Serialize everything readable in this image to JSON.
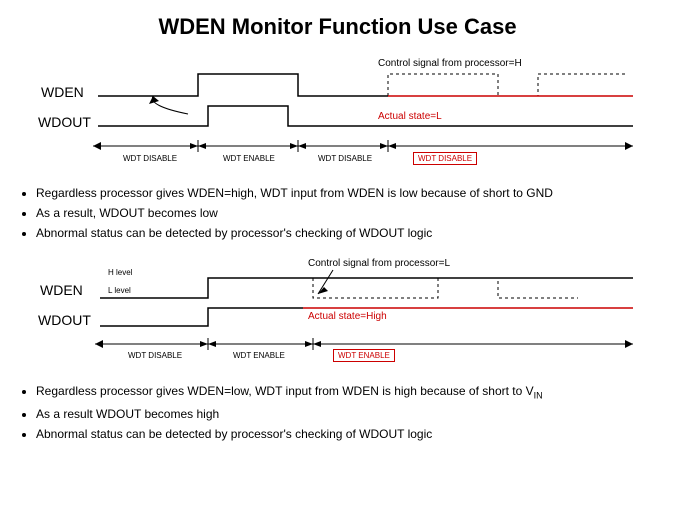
{
  "title": "WDEN Monitor Function Use Case",
  "diagram1": {
    "wden_label": "WDEN",
    "wdout_label": "WDOUT",
    "ctrl_label": "Control signal from processor=H",
    "actual_label": "Actual state=L",
    "seg1": "WDT DISABLE",
    "seg2": "WDT ENABLE",
    "seg3": "WDT DISABLE",
    "seg4": "WDT DISABLE"
  },
  "bullets1": {
    "b1": "Regardless processor gives WDEN=high, WDT input from WDEN is low because of short to GND",
    "b2": "As a result, WDOUT becomes low",
    "b3": "Abnormal status can be detected by processor's checking of WDOUT logic"
  },
  "diagram2": {
    "wden_label": "WDEN",
    "wdout_label": "WDOUT",
    "h_level": "H level",
    "l_level": "L level",
    "ctrl_label": "Control signal from processor=L",
    "actual_label": "Actual state=High",
    "seg1": "WDT DISABLE",
    "seg2": "WDT ENABLE",
    "seg3": "WDT ENABLE"
  },
  "bullets2": {
    "b1_prefix": "Regardless processor gives WDEN=low, WDT input from WDEN is high because of short to V",
    "b1_sub": "IN",
    "b2": "As a result WDOUT becomes high",
    "b3": "Abnormal status can be detected by processor's checking of WDOUT logic"
  },
  "chart_data": [
    {
      "type": "timing-diagram",
      "title": "WDEN short to GND case",
      "signals": [
        {
          "name": "WDEN",
          "processor_intent": "H (after pulse)",
          "actual": "L",
          "segments": [
            "low",
            "high-pulse",
            "low-actual (dotted high = intended)"
          ]
        },
        {
          "name": "WDOUT",
          "actual": "L",
          "segments": [
            "low",
            "high-pulse",
            "low"
          ]
        }
      ],
      "axis_segments": [
        "WDT DISABLE",
        "WDT ENABLE",
        "WDT DISABLE",
        "WDT DISABLE (abnormal)"
      ],
      "annotations": [
        "Control signal from processor=H",
        "Actual state=L"
      ]
    },
    {
      "type": "timing-diagram",
      "title": "WDEN short to VIN case",
      "signals": [
        {
          "name": "WDEN",
          "processor_intent": "L (after step)",
          "actual": "H",
          "segments": [
            "low",
            "step high (actual stays high, dotted low = intended)"
          ]
        },
        {
          "name": "WDOUT",
          "actual": "H",
          "segments": [
            "low",
            "high"
          ]
        }
      ],
      "axis_segments": [
        "WDT DISABLE",
        "WDT ENABLE",
        "WDT ENABLE (abnormal)"
      ],
      "annotations": [
        "Control signal from processor=L",
        "Actual state=High",
        "H level",
        "L level"
      ]
    }
  ]
}
